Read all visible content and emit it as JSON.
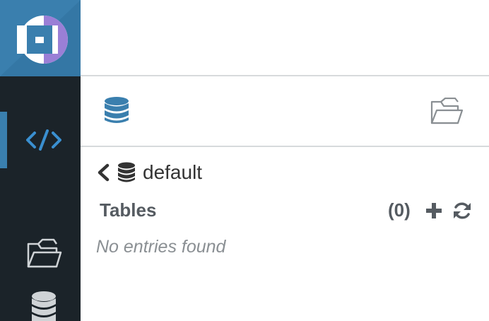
{
  "sidebar": {
    "items": [
      {
        "name": "editor",
        "icon": "code-icon",
        "active": true
      },
      {
        "name": "files",
        "icon": "folder-open-icon",
        "active": false
      },
      {
        "name": "tables",
        "icon": "database-icon",
        "active": false
      }
    ]
  },
  "assist": {
    "tabs": [
      {
        "icon": "database-icon",
        "active": true
      },
      {
        "icon": "folder-open-icon",
        "active": false
      }
    ],
    "database": "default",
    "section_title": "Tables",
    "count": "(0)",
    "empty_message": "No entries found"
  },
  "colors": {
    "accent": "#3a7fae",
    "rail": "#1b2329",
    "logo_purple": "#9a7fd6"
  }
}
